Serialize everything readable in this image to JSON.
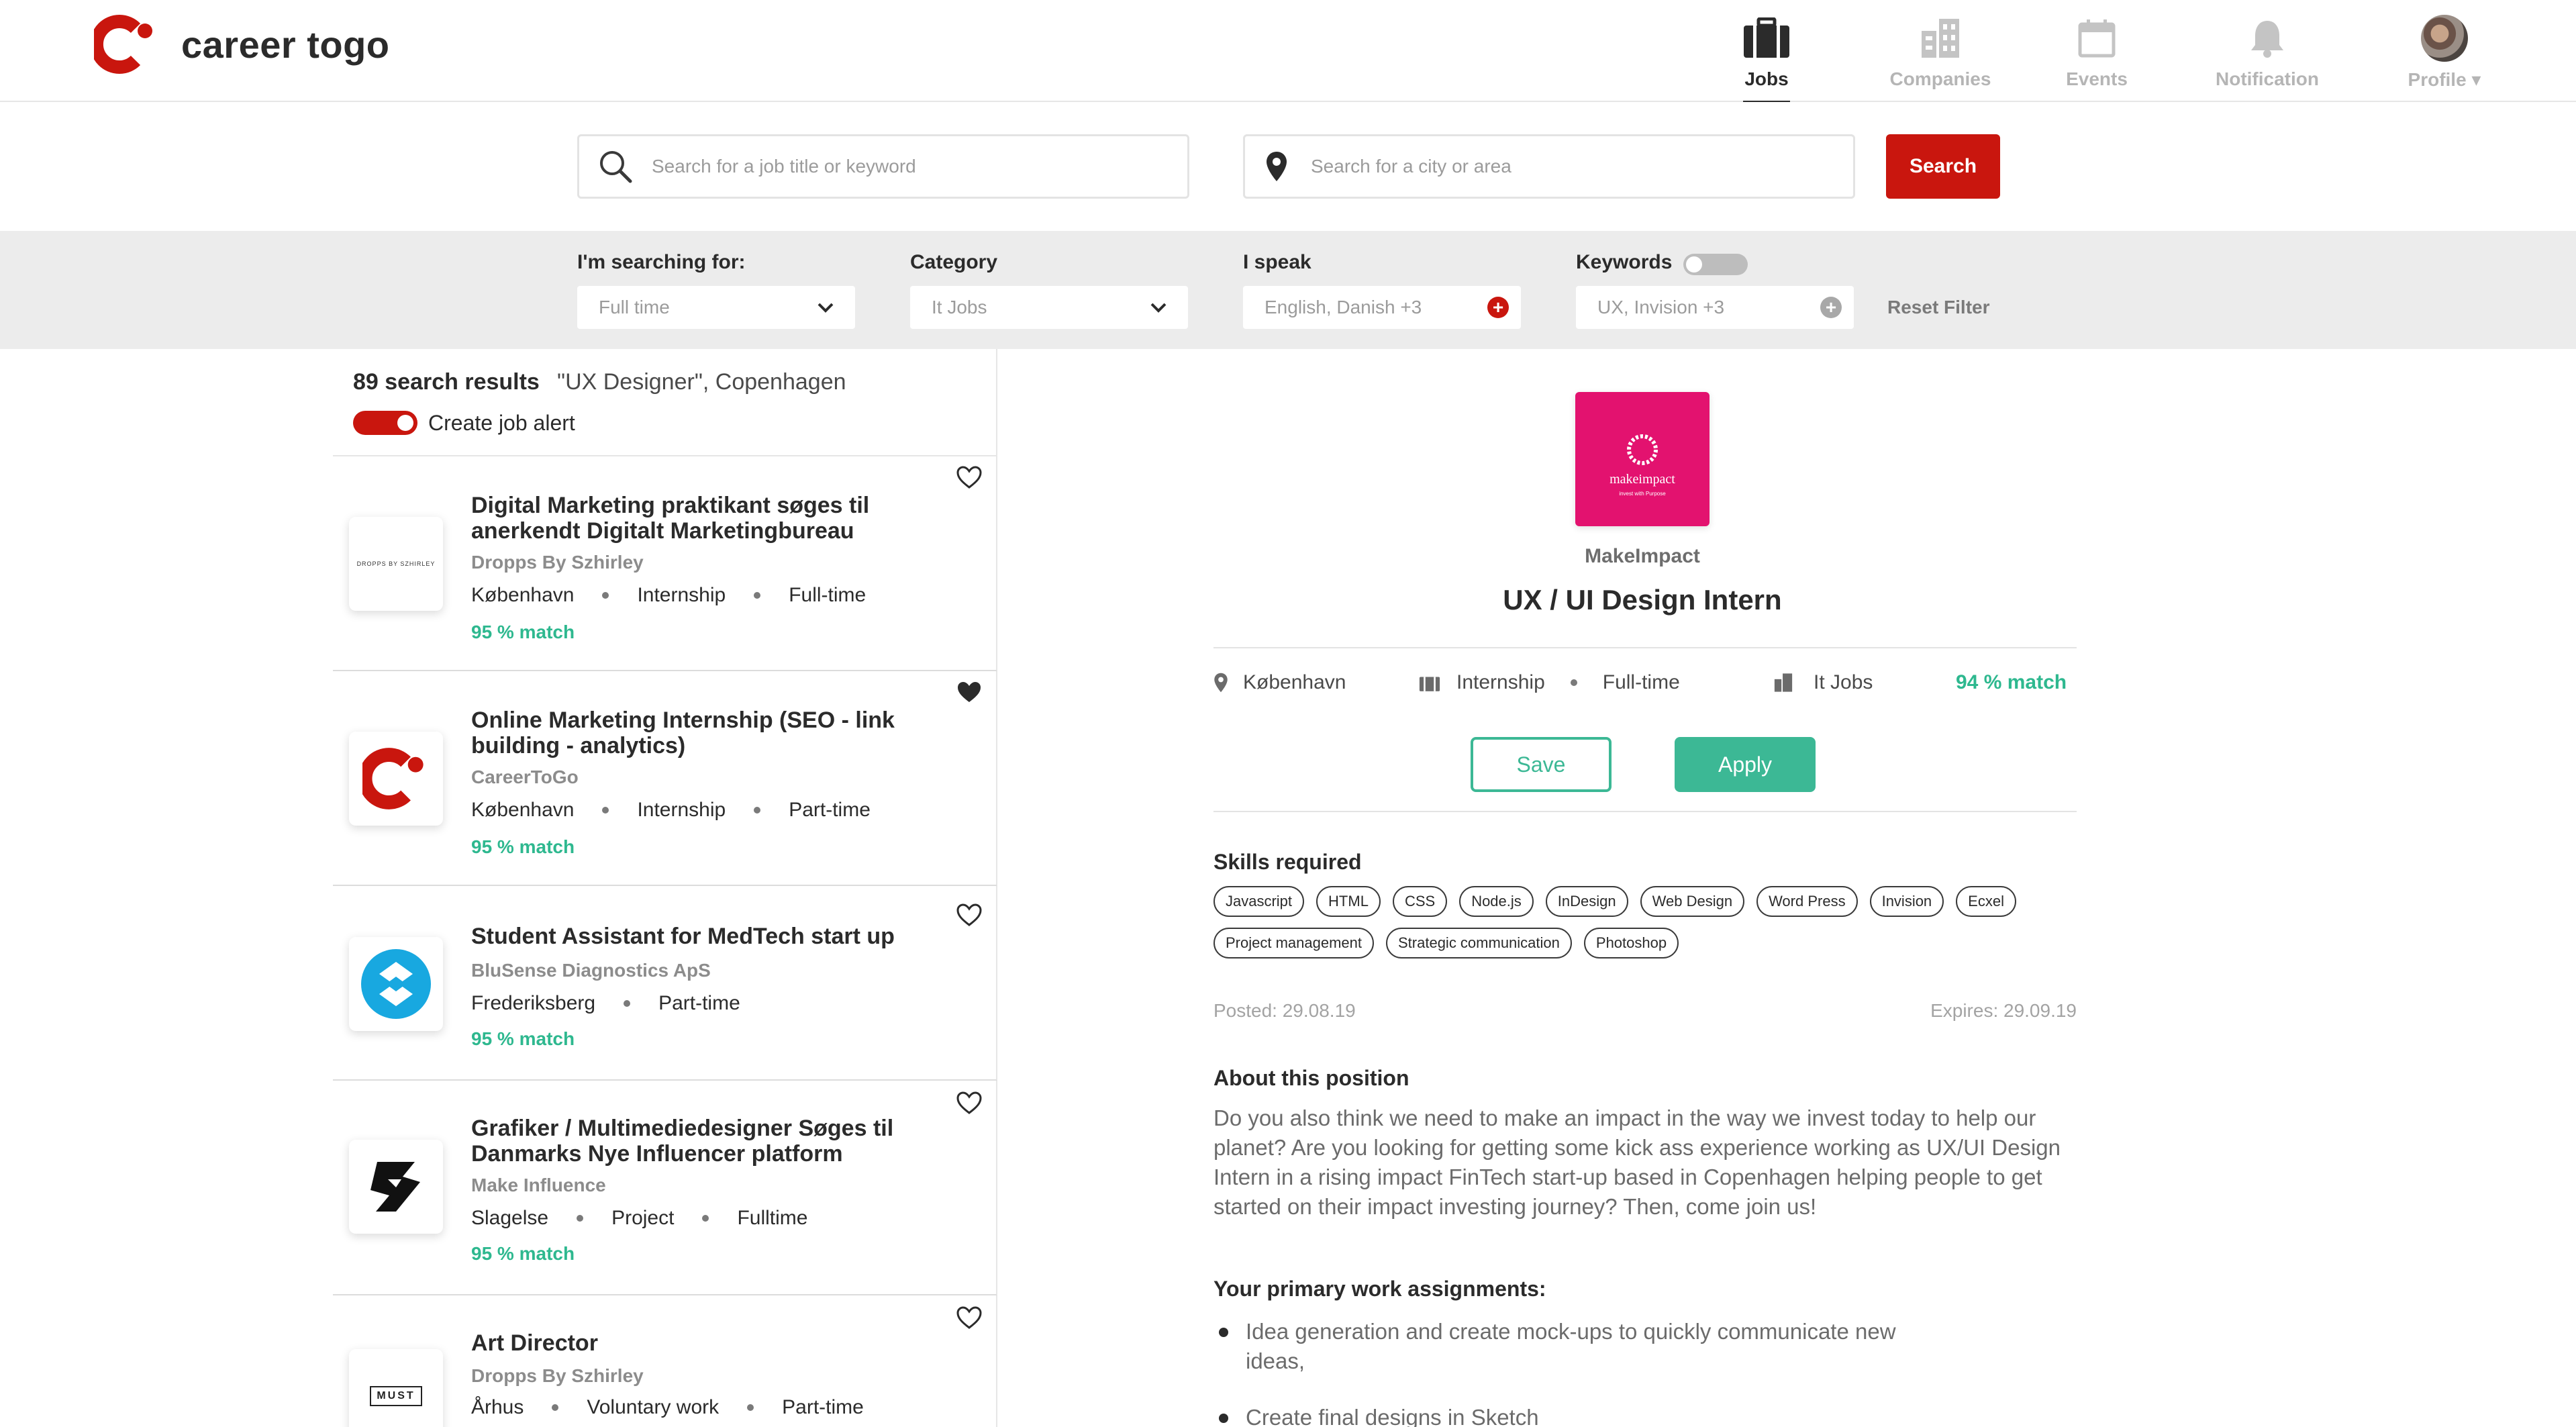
{
  "brand": {
    "name": "career togo",
    "accent": "#c9160e",
    "match_color": "#2eb88f"
  },
  "nav": [
    {
      "label": "Jobs",
      "icon": "briefcase-icon",
      "active": true
    },
    {
      "label": "Companies",
      "icon": "building-icon",
      "active": false
    },
    {
      "label": "Events",
      "icon": "calendar-icon",
      "active": false
    },
    {
      "label": "Notification",
      "icon": "bell-icon",
      "active": false
    },
    {
      "label": "Profile ▾",
      "icon": "avatar",
      "active": false
    }
  ],
  "search": {
    "keyword_placeholder": "Search for a job title or keyword",
    "location_placeholder": "Search for a city or area",
    "button_label": "Search"
  },
  "filters": {
    "searching_label": "I'm searching for:",
    "searching_value": "Full time",
    "category_label": "Category",
    "category_value": "It Jobs",
    "speak_label": "I speak",
    "speak_value": "English, Danish +3",
    "keywords_label": "Keywords",
    "keywords_value": "UX, Invision +3",
    "keywords_toggle_on": false,
    "reset_label": "Reset Filter"
  },
  "results": {
    "count_label": "89 search results",
    "query": "\"UX Designer\", Copenhagen",
    "alert_label": "Create job alert",
    "alert_on": true
  },
  "jobs": [
    {
      "title": "Digital Marketing praktikant søges til anerkendt Digitalt Marketingbureau",
      "company": "Dropps By Szhirley",
      "location": "København",
      "type": "Internship",
      "time": "Full-time",
      "match": "95 % match",
      "saved": false,
      "logo_text": "DROPPS BY SZHIRLEY"
    },
    {
      "title": "Online Marketing Internship (SEO - link building - analytics)",
      "company": "CareerToGo",
      "location": "København",
      "type": "Internship",
      "time": "Part-time",
      "match": "95 % match",
      "saved": true
    },
    {
      "title": "Student Assistant for MedTech start up",
      "company": "BluSense Diagnostics ApS",
      "location": "Frederiksberg",
      "type": "Part-time",
      "match": "95 % match",
      "saved": false
    },
    {
      "title": "Grafiker / Multimediedesigner Søges til Danmarks Nye Influencer platform",
      "company": "Make Influence",
      "location": "Slagelse",
      "type": "Project",
      "time": "Fulltime",
      "match": "95 % match",
      "saved": false
    },
    {
      "title": "Art Director",
      "company": "Dropps By Szhirley",
      "location": "Århus",
      "type": "Voluntary work",
      "time": "Part-time",
      "saved": false,
      "logo_text": "MUST"
    }
  ],
  "detail": {
    "company": "MakeImpact",
    "logo_text": "makeimpact",
    "logo_subtext": "invest with Purpose",
    "title": "UX / UI Design Intern",
    "location": "København",
    "type": "Internship",
    "time": "Full-time",
    "category": "It Jobs",
    "match": "94 % match",
    "save_label": "Save",
    "apply_label": "Apply",
    "skills_heading": "Skills required",
    "skills": [
      "Javascript",
      "HTML",
      "CSS",
      "Node.js",
      "InDesign",
      "Web Design",
      "Word Press",
      "Invision",
      "Ecxel",
      "Project management",
      "Strategic communication",
      "Photoshop"
    ],
    "posted": "Posted: 29.08.19",
    "expires": "Expires: 29.09.19",
    "about_heading": "About this position",
    "about_text": "Do you also think we need to make an impact in the way we invest today to help our planet? Are you looking for getting some kick ass experience working as UX/UI Design Intern in a rising impact FinTech start-up based in Copenhagen helping people to get started on their impact investing journey? Then, come join us!",
    "assignments_heading": "Your primary work assignments:",
    "assignments": [
      "Idea generation and create mock-ups to quickly communicate new ideas,",
      "Create final designs in Sketch"
    ]
  }
}
